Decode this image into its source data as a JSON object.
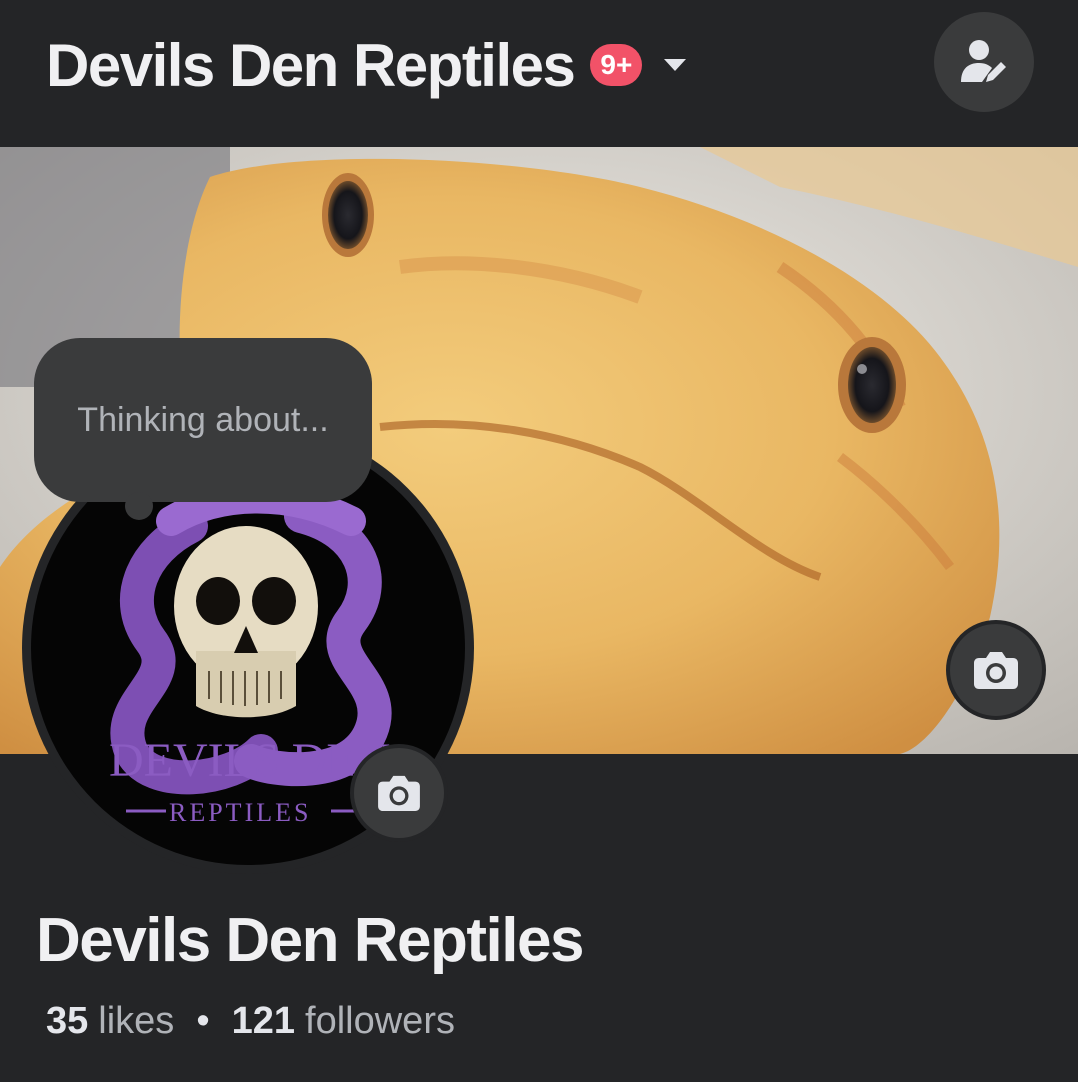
{
  "header": {
    "title": "Devils Den Reptiles",
    "notification_badge": "9+",
    "badge_color": "#f25268",
    "dropdown_icon": "caret-down-icon",
    "profile_switch_icon": "user-edit-icon"
  },
  "cover": {
    "camera_icon": "camera-icon"
  },
  "composer": {
    "placeholder": "Thinking about..."
  },
  "avatar": {
    "logo_line1": "DEVILS DEN",
    "logo_line2": "REPTILES",
    "camera_icon": "camera-icon"
  },
  "profile": {
    "name": "Devils Den Reptiles",
    "likes_count": "35",
    "likes_label": "likes",
    "separator": "•",
    "followers_count": "121",
    "followers_label": "followers"
  },
  "colors": {
    "background": "#242527",
    "button_bg": "#3a3b3c",
    "text_primary": "#f0f0f2",
    "text_secondary": "#b0b3b8"
  }
}
